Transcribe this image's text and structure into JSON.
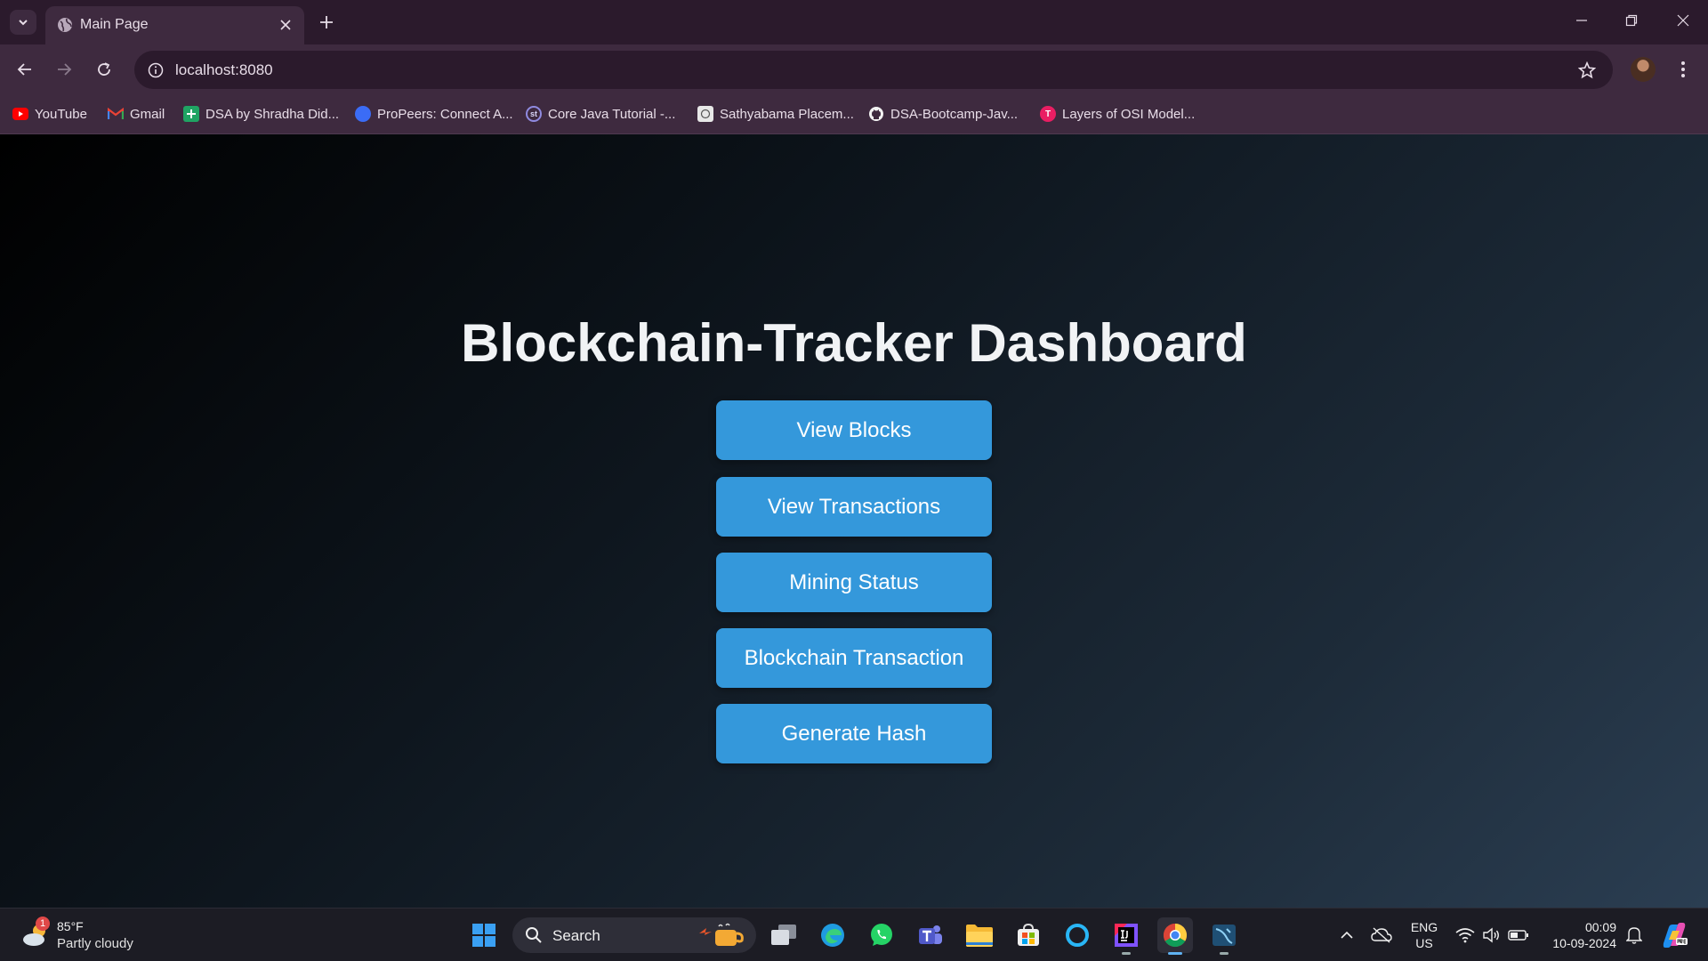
{
  "browser": {
    "tab": {
      "title": "Main Page"
    },
    "address_bar": {
      "url": "localhost:8080"
    },
    "bookmarks": [
      {
        "label": "YouTube",
        "icon": "youtube-icon",
        "color": "#ff0000"
      },
      {
        "label": "Gmail",
        "icon": "gmail-icon",
        "color": "#ea4335"
      },
      {
        "label": "DSA by Shradha Did...",
        "icon": "sheets-icon",
        "color": "#1fa463"
      },
      {
        "label": "ProPeers: Connect A...",
        "icon": "propeers-icon",
        "color": "#3b6cf6"
      },
      {
        "label": "Core Java Tutorial -...",
        "icon": "studytonight-icon",
        "color": "#5b4bd5"
      },
      {
        "label": "Sathyabama Placem...",
        "icon": "sathyabama-icon",
        "color": "#dddddd"
      },
      {
        "label": "DSA-Bootcamp-Jav...",
        "icon": "github-icon",
        "color": "#ffffff"
      },
      {
        "label": "Layers of OSI Model...",
        "icon": "javatpoint-icon",
        "color": "#e91e63"
      }
    ]
  },
  "page": {
    "heading": "Blockchain-Tracker Dashboard",
    "buttons": [
      {
        "label": "View Blocks"
      },
      {
        "label": "View Transactions"
      },
      {
        "label": "Mining Status"
      },
      {
        "label": "Blockchain Transaction"
      },
      {
        "label": "Generate Hash"
      }
    ],
    "button_color": "#3498db"
  },
  "taskbar": {
    "weather": {
      "temp": "85°F",
      "desc": "Partly cloudy",
      "badge": "1"
    },
    "search_label": "Search",
    "tray": {
      "lang_line1": "ENG",
      "lang_line2": "US"
    },
    "clock": {
      "time": "00:09",
      "date": "10-09-2024"
    }
  }
}
